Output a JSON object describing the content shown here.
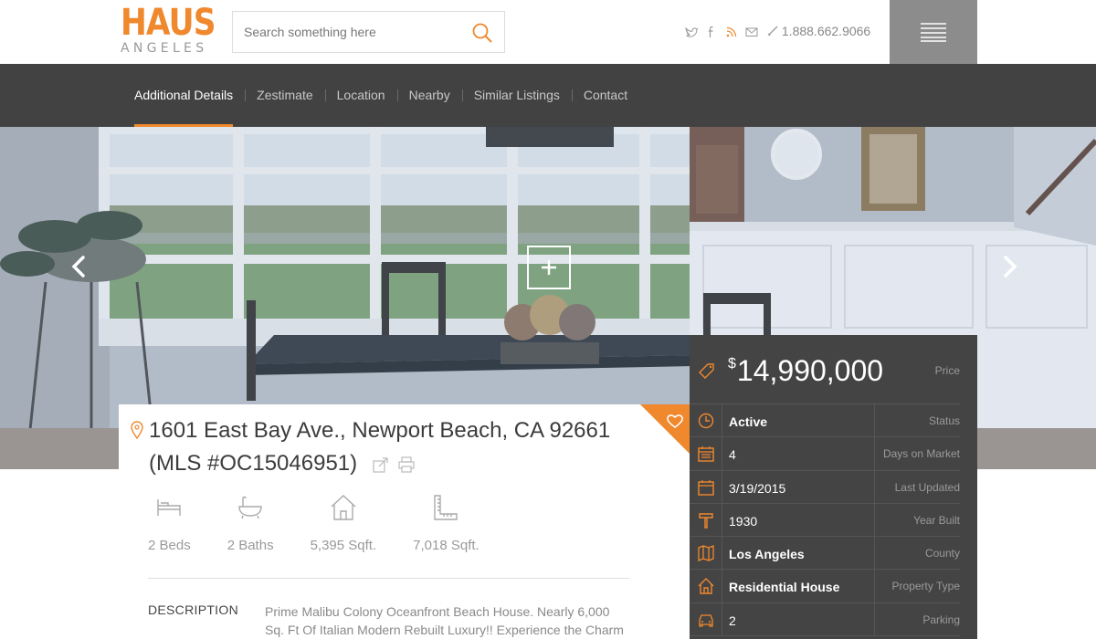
{
  "brand": {
    "name": "HAUS",
    "sub": "ANGELES",
    "accent": "#f0882d"
  },
  "search": {
    "placeholder": "Search something here"
  },
  "social": [
    "twitter-icon",
    "facebook-icon",
    "rss-icon",
    "mail-icon"
  ],
  "phone": "1.888.662.9066",
  "nav": {
    "items": [
      {
        "label": "Additional Details",
        "active": true
      },
      {
        "label": "Zestimate"
      },
      {
        "label": "Location"
      },
      {
        "label": "Nearby"
      },
      {
        "label": "Similar Listings"
      },
      {
        "label": "Contact"
      }
    ]
  },
  "listing": {
    "address": "1601 East Bay Ave., Newport Beach, CA 92661 (MLS #OC15046951)",
    "features": [
      {
        "icon": "bed-icon",
        "label": "2 Beds"
      },
      {
        "icon": "bath-icon",
        "label": "2 Baths"
      },
      {
        "icon": "house-icon",
        "label": "5,395 Sqft."
      },
      {
        "icon": "ruler-icon",
        "label": "7,018 Sqft."
      }
    ],
    "description_title": "DESCRIPTION",
    "description": "Prime Malibu Colony Oceanfront Beach House. Nearly 6,000 Sq. Ft Of Italian Modern Rebuilt Luxury!! Experience the Charm"
  },
  "details": {
    "currency": "$",
    "price": "14,990,000",
    "price_label": "Price",
    "rows": [
      {
        "icon": "clock-icon",
        "value": "Active",
        "label": "Status",
        "bold": true
      },
      {
        "icon": "calendar-icon",
        "value": "4",
        "label": "Days on Market"
      },
      {
        "icon": "calendar-check-icon",
        "value": "3/19/2015",
        "label": "Last Updated"
      },
      {
        "icon": "hammer-icon",
        "value": "1930",
        "label": "Year Built"
      },
      {
        "icon": "map-icon",
        "value": "Los Angeles",
        "label": "County",
        "bold": true
      },
      {
        "icon": "home-icon",
        "value": "Residential House",
        "label": "Property Type",
        "bold": true
      },
      {
        "icon": "car-icon",
        "value": "2",
        "label": "Parking"
      }
    ]
  }
}
